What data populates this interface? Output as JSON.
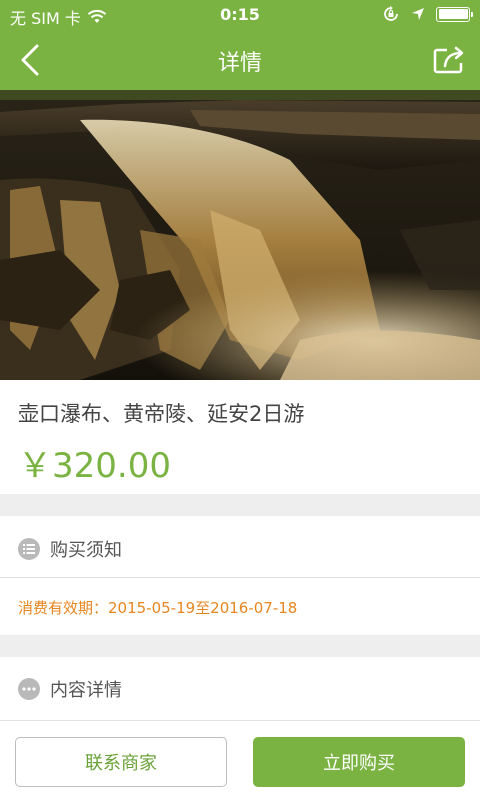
{
  "status_bar": {
    "carrier": "无 SIM 卡",
    "time": "0:15"
  },
  "nav": {
    "title": "详情",
    "back_icon": "chevron-left-icon",
    "share_icon": "share-icon"
  },
  "product": {
    "title": "壶口瀑布、黄帝陵、延安2日游",
    "price": "￥320.00"
  },
  "purchase_notice": {
    "heading": "购买须知",
    "validity": "消费有效期：2015-05-19至2016-07-18"
  },
  "content_details": {
    "heading": "内容详情"
  },
  "actions": {
    "contact_label": "联系商家",
    "buy_label": "立即购买"
  },
  "colors": {
    "brand_green": "#7ab341",
    "validity_orange": "#e7851e"
  }
}
